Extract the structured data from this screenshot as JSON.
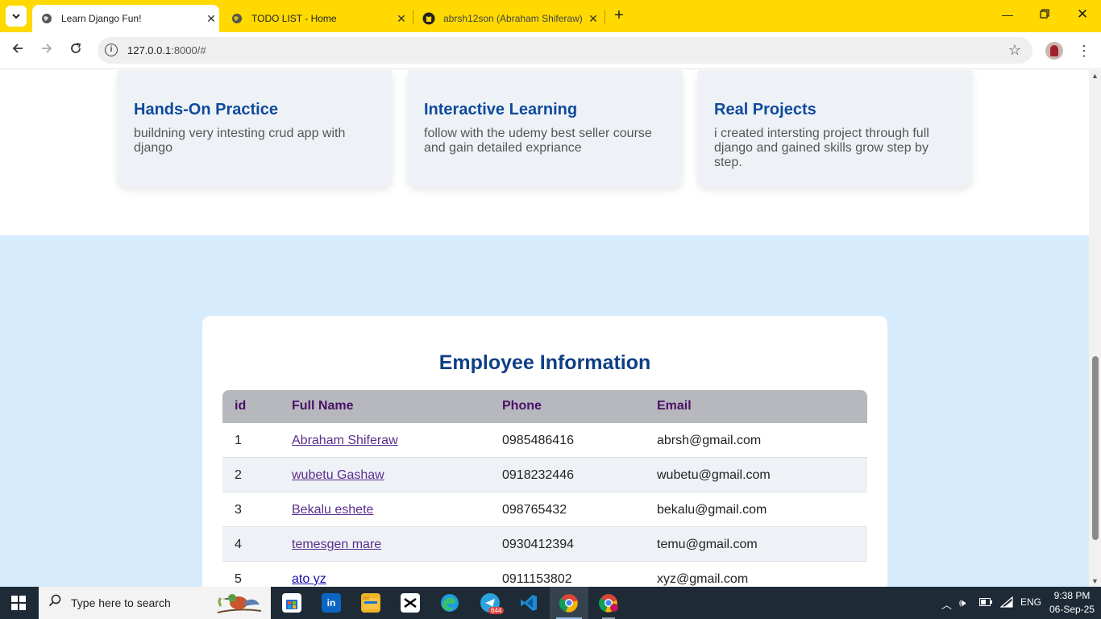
{
  "browser": {
    "tabs": [
      {
        "title": "Learn Django Fun!",
        "active": true
      },
      {
        "title": "TODO LIST - Home",
        "active": false
      },
      {
        "title": "abrsh12son (Abraham Shiferaw)",
        "active": false
      }
    ],
    "url_host": "127.0.0.1",
    "url_rest": ":8000/#"
  },
  "features": [
    {
      "title": "Hands-On Practice",
      "text": "buildning very intesting crud app with django"
    },
    {
      "title": "Interactive Learning",
      "text": "follow with the udemy best seller course and gain detailed expriance"
    },
    {
      "title": "Real Projects",
      "text": "i created intersting project through full django and gained skills grow step by step."
    }
  ],
  "employees": {
    "heading": "Employee Information",
    "columns": [
      "id",
      "Full Name",
      "Phone",
      "Email"
    ],
    "rows": [
      {
        "id": "1",
        "name": "Abraham Shiferaw",
        "phone": "0985486416",
        "email": "abrsh@gmail.com"
      },
      {
        "id": "2",
        "name": "wubetu Gashaw",
        "phone": "0918232446",
        "email": "wubetu@gmail.com"
      },
      {
        "id": "3",
        "name": "Bekalu eshete",
        "phone": "098765432",
        "email": "bekalu@gmail.com"
      },
      {
        "id": "4",
        "name": "temesgen mare",
        "phone": "0930412394",
        "email": "temu@gmail.com"
      },
      {
        "id": "5",
        "name": "ato yz",
        "phone": "0911153802",
        "email": "xyz@gmail.com"
      }
    ]
  },
  "taskbar": {
    "search_placeholder": "Type here to search",
    "telegram_badge": "644",
    "language": "ENG",
    "time": "9:38 PM",
    "date": "06-Sep-25"
  }
}
